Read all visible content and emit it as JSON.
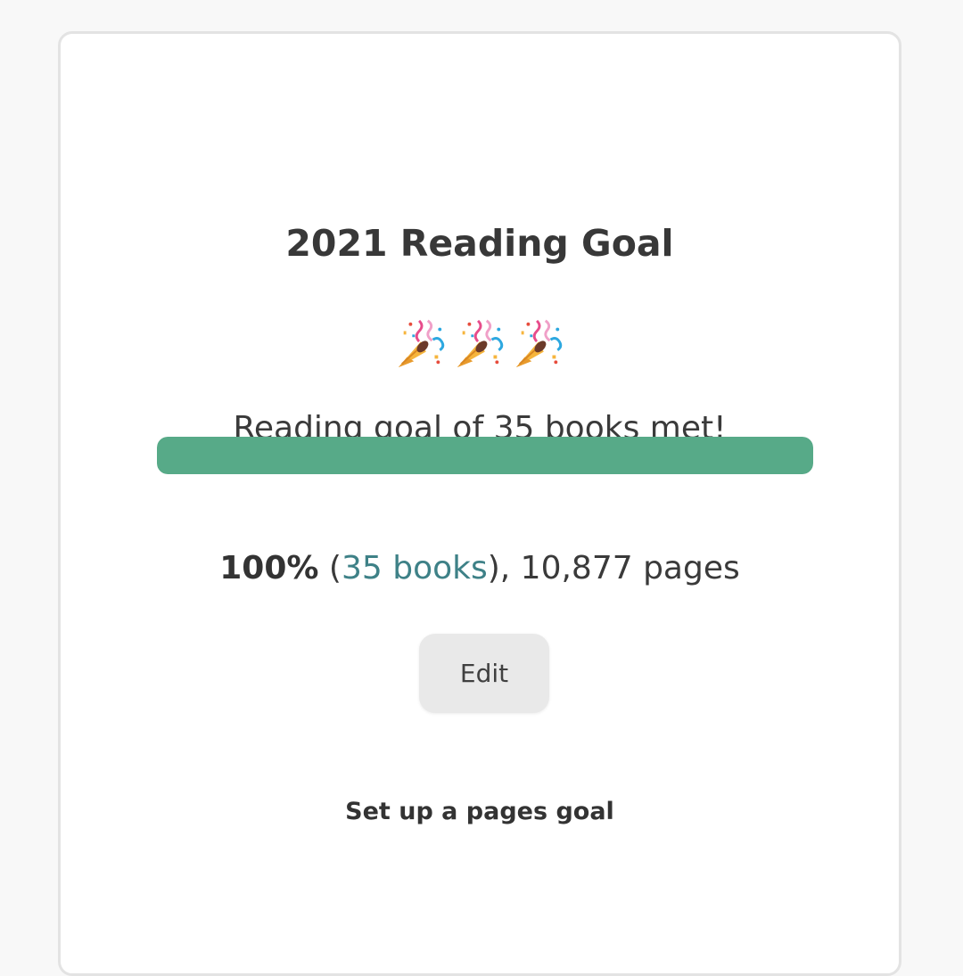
{
  "goal_card": {
    "title": "2021 Reading Goal",
    "celebration_icon": "party-popper-icon",
    "celebration_count": 3,
    "status_message": "Reading goal of 35 books met!",
    "progress_fraction": 1.0,
    "progress_color": "#57aa88",
    "stats": {
      "percent": "100%",
      "paren_open": " (",
      "books_link": "35 books",
      "paren_close_and_pages": "), 10,877 pages"
    },
    "edit_label": "Edit",
    "pages_goal_link": "Set up a pages goal"
  }
}
